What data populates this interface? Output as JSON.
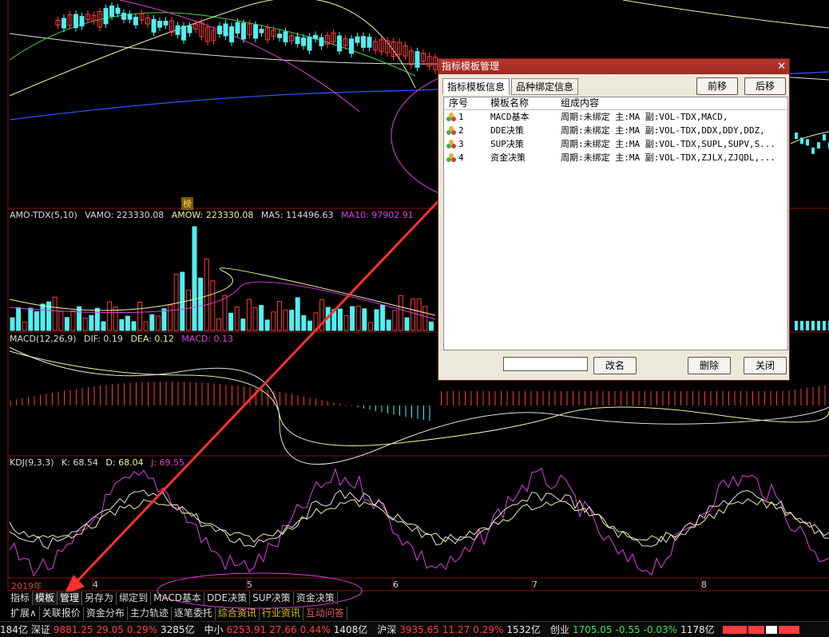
{
  "panels": {
    "amo": {
      "name": "AMO-TDX(5,10)",
      "vamo": "VAMO: 223330.08",
      "amow": "AMOW: 223330.08",
      "ma5": "MA5: 114496.63",
      "ma10": "MA10: 97902.91"
    },
    "macd": {
      "name": "MACD(12,26,9)",
      "dif": "DIF: 0.19",
      "dea": "DEA: 0.12",
      "macd": "MACD: 0.13"
    },
    "kdj": {
      "name": "KDJ(9,3,3)",
      "k": "K: 68.54",
      "d": "D: 68.04",
      "j": "J: 69.55"
    }
  },
  "bang_badge": "榜",
  "date_axis": [
    "2019年",
    "4",
    "5",
    "6",
    "7",
    "8"
  ],
  "toolbar_row1": [
    "指标",
    "模板",
    "管理",
    "另存为",
    "绑定到",
    "MACD基本",
    "DDE决策",
    "SUP决策",
    "资金决策"
  ],
  "toolbar_row2": [
    "扩展∧",
    "关联报价",
    "资金分布",
    "主力轨迹",
    "逐笔委托",
    "综合资讯",
    "行业资讯",
    "互动问答"
  ],
  "status_bar": {
    "lead": "184亿",
    "sz_name": "深证",
    "sz_val": "9881.25",
    "sz_chg": "29.05",
    "sz_pct": "0.29%",
    "sz_amt": "3285亿",
    "zx_name": "中小",
    "zx_val": "6253.91",
    "zx_chg": "27.66",
    "zx_pct": "0.44%",
    "zx_amt": "1408亿",
    "hs_name": "沪深",
    "hs_val": "3935.65",
    "hs_chg": "11.27",
    "hs_pct": "0.29%",
    "hs_amt": "1532亿",
    "cy_name": "创业",
    "cy_val": "1705.05",
    "cy_chg": "-0.55",
    "cy_pct": "-0.03%",
    "cy_amt": "1178亿"
  },
  "dialog": {
    "title": "指标模板管理",
    "close": "✕",
    "tabs": [
      "指标模板信息",
      "品种绑定信息"
    ],
    "btn_prev": "前移",
    "btn_next": "后移",
    "columns": [
      "序号",
      "模板名称",
      "组成内容"
    ],
    "rows": [
      {
        "no": "1",
        "name": "MACD基本",
        "content": "周期:未绑定 主:MA 副:VOL-TDX,MACD,"
      },
      {
        "no": "2",
        "name": "DDE决策",
        "content": "周期:未绑定 主:MA 副:VOL-TDX,DDX,DDY,DDZ,"
      },
      {
        "no": "3",
        "name": "SUP决策",
        "content": "周期:未绑定 主:MA 副:VOL-TDX,SUPL,SUPV,S..."
      },
      {
        "no": "4",
        "name": "资金决策",
        "content": "周期:未绑定 主:MA 副:VOL-TDX,ZJLX,ZJQDL,..."
      }
    ],
    "input_value": "",
    "btn_rename": "改名",
    "btn_delete": "删除",
    "btn_close": "关闭"
  },
  "colors": {
    "up": "#ff3b3b",
    "down": "#3be04b",
    "cyan": "#4ff0f0",
    "magenta": "#e040e0",
    "yellow": "#f0f0a0",
    "panel_border": "#8b1010"
  }
}
